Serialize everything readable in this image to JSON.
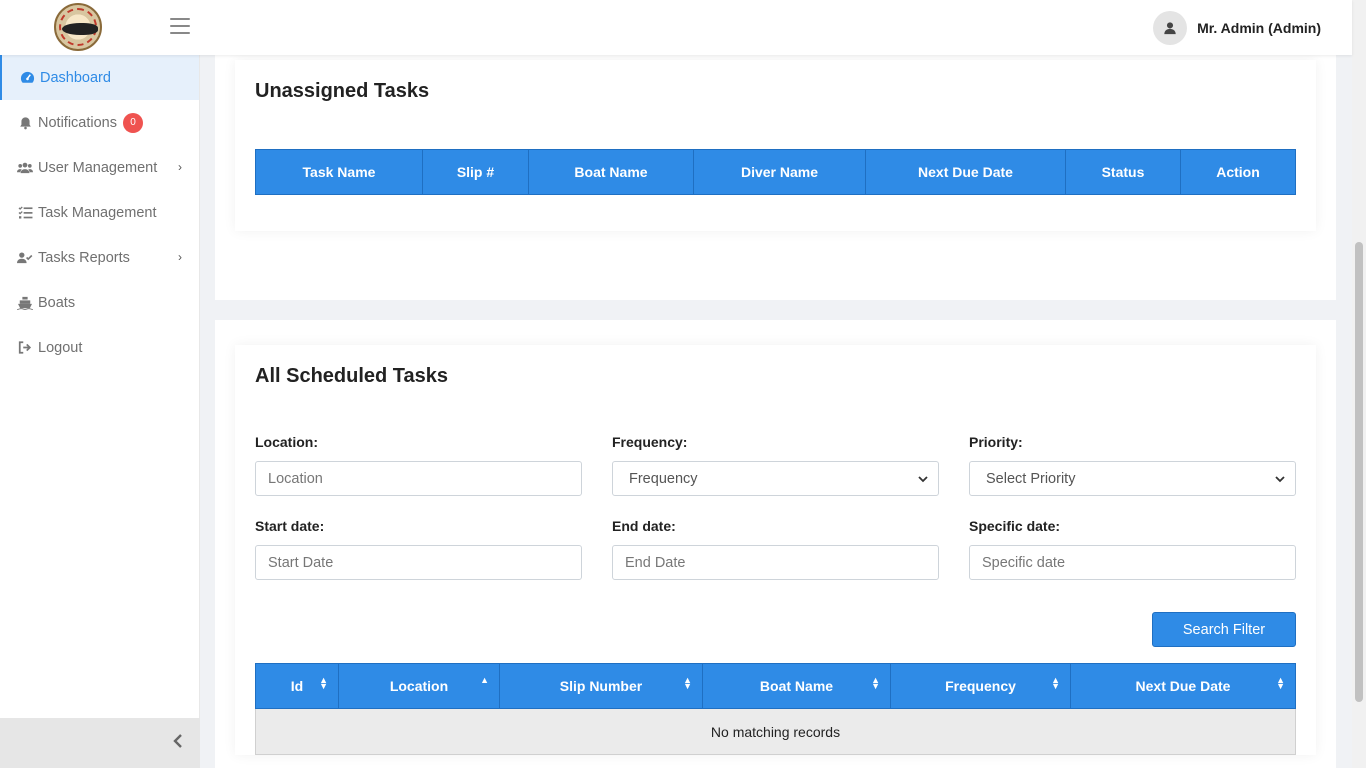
{
  "header": {
    "user_name": "Mr. Admin (Admin)"
  },
  "sidebar": {
    "items": [
      {
        "label": "Dashboard",
        "icon": "tachometer-icon"
      },
      {
        "label": "Notifications",
        "icon": "bell-icon",
        "badge": "0"
      },
      {
        "label": "User Management",
        "icon": "users-icon"
      },
      {
        "label": "Task Management",
        "icon": "task-list-icon"
      },
      {
        "label": "Tasks Reports",
        "icon": "user-check-icon"
      },
      {
        "label": "Boats",
        "icon": "ship-icon"
      },
      {
        "label": "Logout",
        "icon": "sign-out-icon"
      }
    ]
  },
  "unassigned": {
    "title": "Unassigned Tasks",
    "columns": [
      "Task Name",
      "Slip #",
      "Boat Name",
      "Diver Name",
      "Next Due Date",
      "Status",
      "Action"
    ]
  },
  "scheduled": {
    "title": "All Scheduled Tasks",
    "filters": {
      "location": {
        "label": "Location:",
        "placeholder": "Location"
      },
      "frequency": {
        "label": "Frequency:",
        "value": "Frequency"
      },
      "priority": {
        "label": "Priority:",
        "value": "Select Priority"
      },
      "start_date": {
        "label": "Start date:",
        "placeholder": "Start Date"
      },
      "end_date": {
        "label": "End date:",
        "placeholder": "End Date"
      },
      "specific_date": {
        "label": "Specific date:",
        "placeholder": "Specific date"
      }
    },
    "search_button": "Search Filter",
    "columns": [
      "Id",
      "Location",
      "Slip Number",
      "Boat Name",
      "Frequency",
      "Next Due Date"
    ],
    "empty_text": "No matching records"
  },
  "colors": {
    "primary": "#2f8be6",
    "badge": "#ef5350"
  }
}
